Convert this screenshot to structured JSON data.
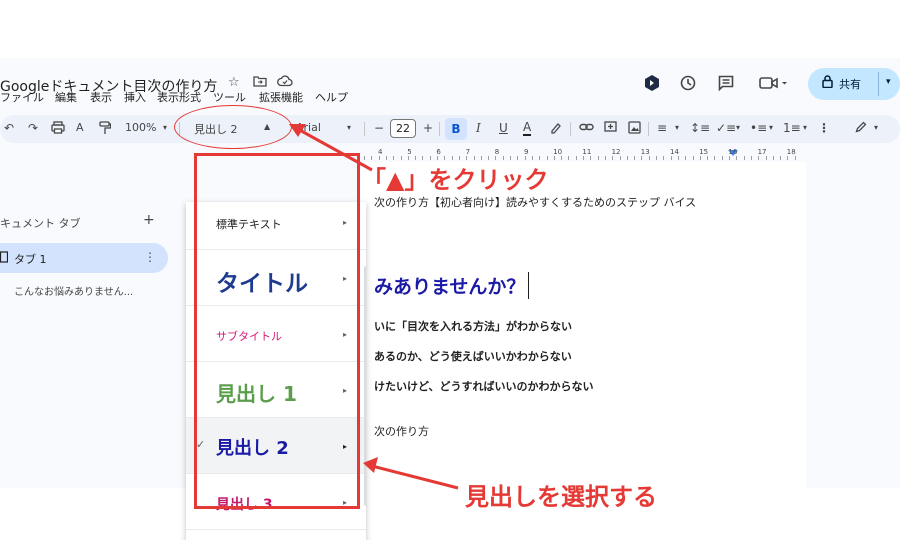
{
  "app": {
    "doc_title": "Googleドキュメント目次の作り方",
    "icons": {
      "star": "star-icon",
      "folder": "move-folder-icon",
      "cloud": "cloud-saved-icon"
    }
  },
  "menu": [
    "ファイル",
    "編集",
    "表示",
    "挿入",
    "表示形式",
    "ツール",
    "拡張機能",
    "ヘルプ"
  ],
  "top_right": {
    "share_label": "共有",
    "icons": [
      "gemini-icon",
      "history-icon",
      "comment-icon",
      "meet-icon",
      "lock-icon"
    ]
  },
  "toolbar": {
    "zoom": "100%",
    "paragraph_style": "見出し 2",
    "font": "Arial",
    "font_size": "22",
    "bold": "B",
    "italic": "I",
    "underline": "U",
    "text_color": "A"
  },
  "ruler": {
    "numbers": [
      "4",
      "5",
      "6",
      "7",
      "8",
      "9",
      "10",
      "11",
      "12",
      "13",
      "14",
      "15",
      "16",
      "17",
      "18"
    ]
  },
  "sidebar": {
    "title": "キュメント タブ",
    "add": "+",
    "tab_label": "タブ 1",
    "outline_item": "こんなお悩みありません..."
  },
  "document": {
    "subtitle_line": "次の作り方【初心者向け】読みやすくするためのステップ バイス",
    "heading": "みありませんか？",
    "bullets": [
      "いに「目次を入れる方法」がわからない",
      "あるのか、どう使えばいいかわからない",
      "けたいけど、どうすればいいのかわからない"
    ],
    "plain_line": "次の作り方"
  },
  "dropdown": {
    "items": [
      {
        "label": "標準テキスト"
      },
      {
        "label": "タイトル"
      },
      {
        "label": "サブタイトル"
      },
      {
        "label": "見出し 1"
      },
      {
        "label": "見出し 2",
        "checked": true
      },
      {
        "label": "見出し 3"
      }
    ],
    "check_mark": "✓",
    "arrow": "▸"
  },
  "annotations": {
    "click_text": "「▲」をクリック",
    "select_text": "見出しを選択する",
    "color": "#e53935"
  },
  "colors": {
    "accent": "#0b57d0",
    "heading2": "#1a1aa6",
    "title_blue": "#1d3b8f",
    "subtitle_pink": "#d81b7a",
    "heading1_green": "#5a9e4b",
    "heading3_magenta": "#c2186b"
  }
}
